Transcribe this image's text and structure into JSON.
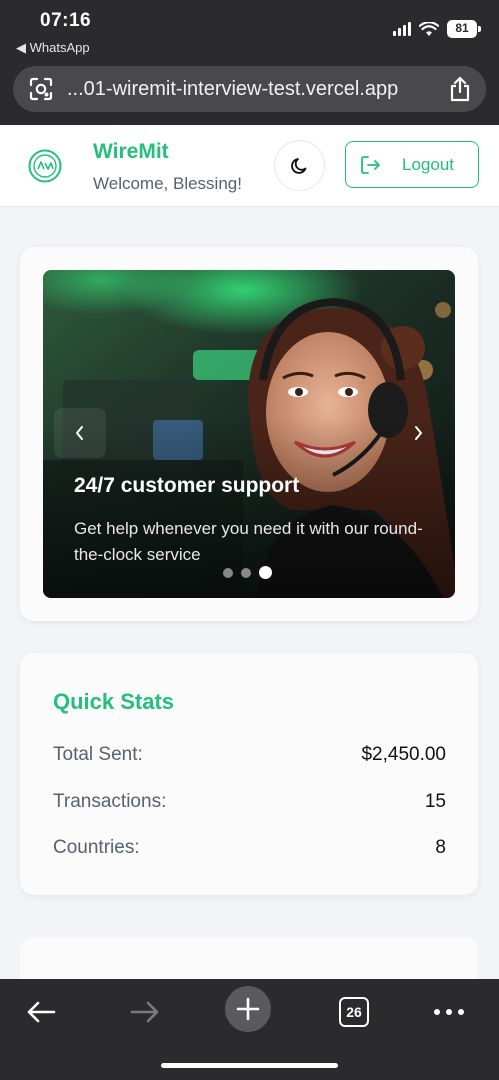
{
  "status_bar": {
    "time": "07:16",
    "back_app": "◀ WhatsApp",
    "battery": "81"
  },
  "browser": {
    "url": "...01-wiremit-interview-test.vercel.app",
    "tabs_count": "26"
  },
  "header": {
    "brand": "WireMit",
    "welcome": "Welcome, Blessing!",
    "logout_label": "Logout"
  },
  "carousel": {
    "title": "24/7 customer support",
    "description": "Get help whenever you need it with our round-the-clock service",
    "slide_count": 3,
    "active_slide": 3
  },
  "stats": {
    "title": "Quick Stats",
    "rows": [
      {
        "label": "Total Sent:",
        "value": "$2,450.00"
      },
      {
        "label": "Transactions:",
        "value": "15"
      },
      {
        "label": "Countries:",
        "value": "8"
      }
    ]
  },
  "colors": {
    "accent": "#22c07a",
    "chrome": "#2b2b2d"
  },
  "icons": [
    "camera-lens-icon",
    "share-icon",
    "logo-icon",
    "moon-icon",
    "logout-icon",
    "chevron-left-icon",
    "chevron-right-icon",
    "back-arrow-icon",
    "forward-arrow-icon",
    "plus-icon",
    "tabs-icon",
    "more-icon"
  ]
}
